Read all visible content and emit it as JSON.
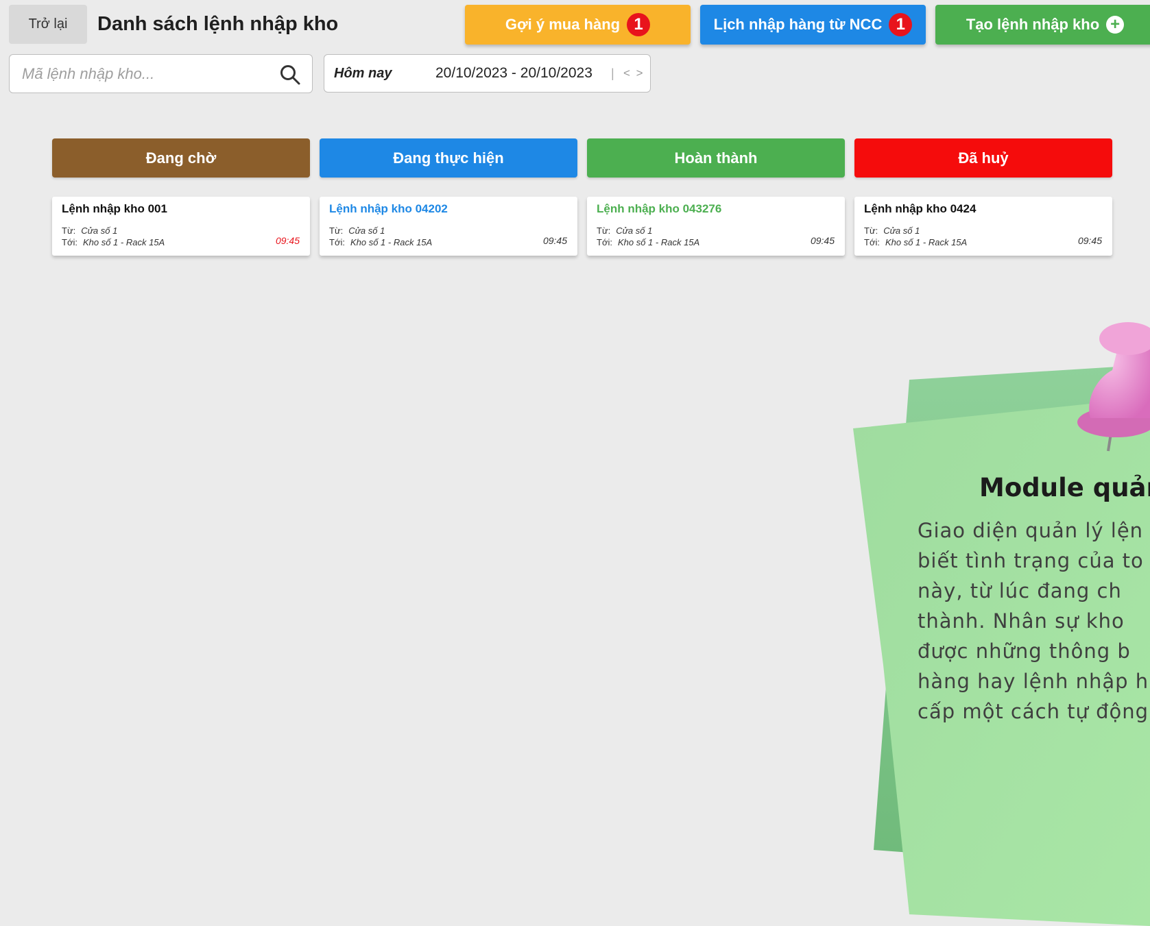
{
  "header": {
    "back_label": "Trở lại",
    "title": "Danh sách lệnh nhập kho",
    "suggest_label": "Gợi ý mua hàng",
    "suggest_badge": "1",
    "schedule_label": "Lịch nhập hàng từ NCC",
    "schedule_badge": "1",
    "create_label": "Tạo lệnh nhập kho"
  },
  "search": {
    "placeholder": "Mã lệnh nhập kho..."
  },
  "date_filter": {
    "preset": "Hôm nay",
    "range": "20/10/2023 - 20/10/2023",
    "separator": "|",
    "nav": "< >"
  },
  "columns": [
    {
      "status": "Đang chờ",
      "color": "#8b5e2b",
      "card": {
        "title": "Lệnh nhập kho 001",
        "from_label": "Từ:",
        "from": "Cửa số 1",
        "to_label": "Tới:",
        "to": "Kho số 1 - Rack 15A",
        "time": "09:45"
      }
    },
    {
      "status": "Đang thực hiện",
      "color": "#1e88e5",
      "card": {
        "title": "Lệnh nhập kho 04202",
        "from_label": "Từ:",
        "from": "Cửa số 1",
        "to_label": "Tới:",
        "to": "Kho số 1 - Rack 15A",
        "time": "09:45"
      }
    },
    {
      "status": "Hoàn thành",
      "color": "#4caf50",
      "card": {
        "title": "Lệnh nhập kho 043276",
        "from_label": "Từ:",
        "from": "Cửa số 1",
        "to_label": "Tới:",
        "to": "Kho số 1 - Rack 15A",
        "time": "09:45"
      }
    },
    {
      "status": "Đã huỷ",
      "color": "#f50c0c",
      "card": {
        "title": "Lệnh nhập kho 0424",
        "from_label": "Từ:",
        "from": "Cửa số 1",
        "to_label": "Tới:",
        "to": "Kho số 1 - Rack 15A",
        "time": "09:45"
      }
    }
  ],
  "note": {
    "title": "Module quản",
    "lines": [
      "Giao diện quản lý lện",
      "biết tình trạng của to",
      "này, từ lúc đang ch",
      "thành. Nhân sự kho",
      "được những thông b",
      "hàng hay lệnh nhập h",
      "cấp một cách tự động"
    ]
  },
  "icons": {
    "search": "search-icon",
    "create": "plus-circle-icon",
    "pin": "push-pin-icon"
  }
}
